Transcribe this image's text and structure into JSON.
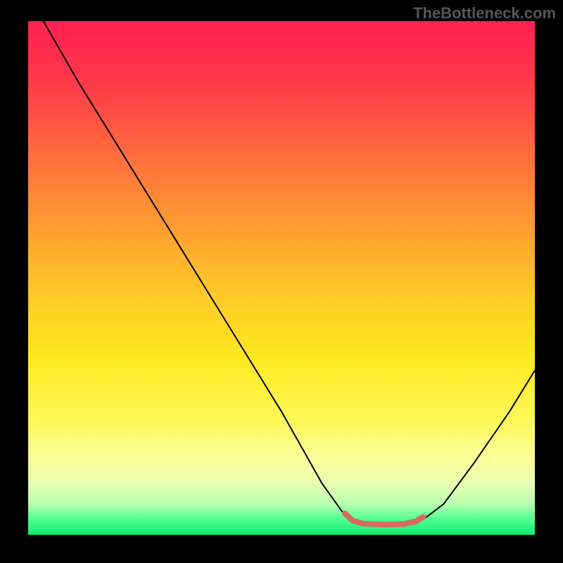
{
  "watermark": "TheBottleneck.com",
  "chart_data": {
    "type": "line",
    "title": "",
    "xlabel": "",
    "ylabel": "",
    "xlim": [
      0,
      100
    ],
    "ylim": [
      0,
      100
    ],
    "background_gradient_stops": [
      {
        "offset": 0,
        "color": "#ff2050"
      },
      {
        "offset": 12,
        "color": "#ff3a49"
      },
      {
        "offset": 30,
        "color": "#ff7a3a"
      },
      {
        "offset": 50,
        "color": "#ffbf2a"
      },
      {
        "offset": 65,
        "color": "#ffe81f"
      },
      {
        "offset": 78,
        "color": "#fff85a"
      },
      {
        "offset": 85,
        "color": "#fbff9a"
      },
      {
        "offset": 90,
        "color": "#e8ffb0"
      },
      {
        "offset": 94,
        "color": "#b8ffb0"
      },
      {
        "offset": 97,
        "color": "#50ff90"
      },
      {
        "offset": 100,
        "color": "#10e870"
      }
    ],
    "series": [
      {
        "name": "bottleneck-curve",
        "color": "#000000",
        "stroke_width": 2,
        "points": [
          {
            "x": 3,
            "y": 100
          },
          {
            "x": 10,
            "y": 88
          },
          {
            "x": 20,
            "y": 72
          },
          {
            "x": 30,
            "y": 56
          },
          {
            "x": 40,
            "y": 40
          },
          {
            "x": 50,
            "y": 24
          },
          {
            "x": 58,
            "y": 10
          },
          {
            "x": 62,
            "y": 4.5
          },
          {
            "x": 65,
            "y": 2.2
          },
          {
            "x": 70,
            "y": 1.8
          },
          {
            "x": 75,
            "y": 2.0
          },
          {
            "x": 78,
            "y": 3.0
          },
          {
            "x": 82,
            "y": 6
          },
          {
            "x": 88,
            "y": 14
          },
          {
            "x": 95,
            "y": 24
          },
          {
            "x": 100,
            "y": 32
          }
        ]
      },
      {
        "name": "optimal-zone-marker",
        "color": "#d86a63",
        "stroke_width": 8,
        "points": [
          {
            "x": 62.5,
            "y": 4.2
          },
          {
            "x": 64,
            "y": 2.8
          },
          {
            "x": 66,
            "y": 2.2
          },
          {
            "x": 70,
            "y": 2.0
          },
          {
            "x": 74,
            "y": 2.1
          },
          {
            "x": 76.5,
            "y": 2.6
          },
          {
            "x": 78,
            "y": 3.5
          }
        ]
      }
    ]
  }
}
